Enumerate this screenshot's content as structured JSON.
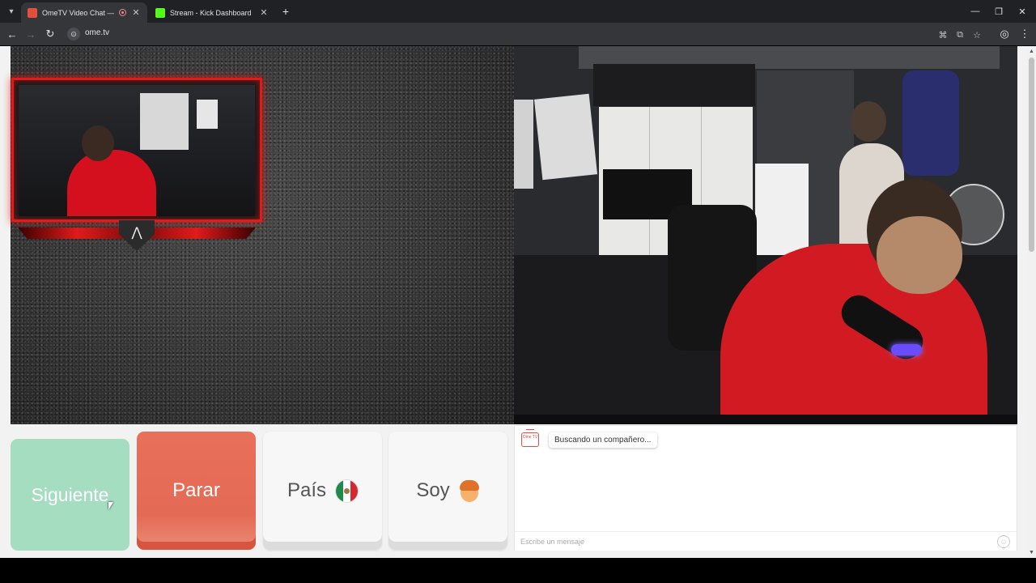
{
  "browser": {
    "tabs": [
      {
        "title": "OmeTV Video Chat — Omegl",
        "active": true,
        "favicon_color": "#e0503c"
      },
      {
        "title": "Stream - Kick Dashboard",
        "active": false,
        "favicon_color": "#53fc18"
      }
    ],
    "new_tab_symbol": "+",
    "tab_close_symbol": "✕",
    "window_controls": {
      "minimize": "—",
      "restore": "❐",
      "close": "✕"
    },
    "nav": {
      "back": "←",
      "forward": "→",
      "reload": "↻"
    },
    "url": "ome.tv",
    "omnibox_icons": [
      "translate-icon",
      "install-app-icon",
      "bookmark-star-icon"
    ],
    "profile_icon": "profile-icon",
    "menu_icon": "⋮"
  },
  "page": {
    "buttons": {
      "next": "Siguiente",
      "stop": "Parar",
      "country": "País",
      "gender": "Soy"
    },
    "chat": {
      "logo_text": "Ome TV",
      "status_message": "Buscando un compañero...",
      "input_placeholder": "Escribe un mensaje"
    }
  },
  "colors": {
    "next_button": "#a5ddc1",
    "stop_button": "#e46a55",
    "overlay_frame": "#e01b1b",
    "brand": "#e0503c"
  }
}
